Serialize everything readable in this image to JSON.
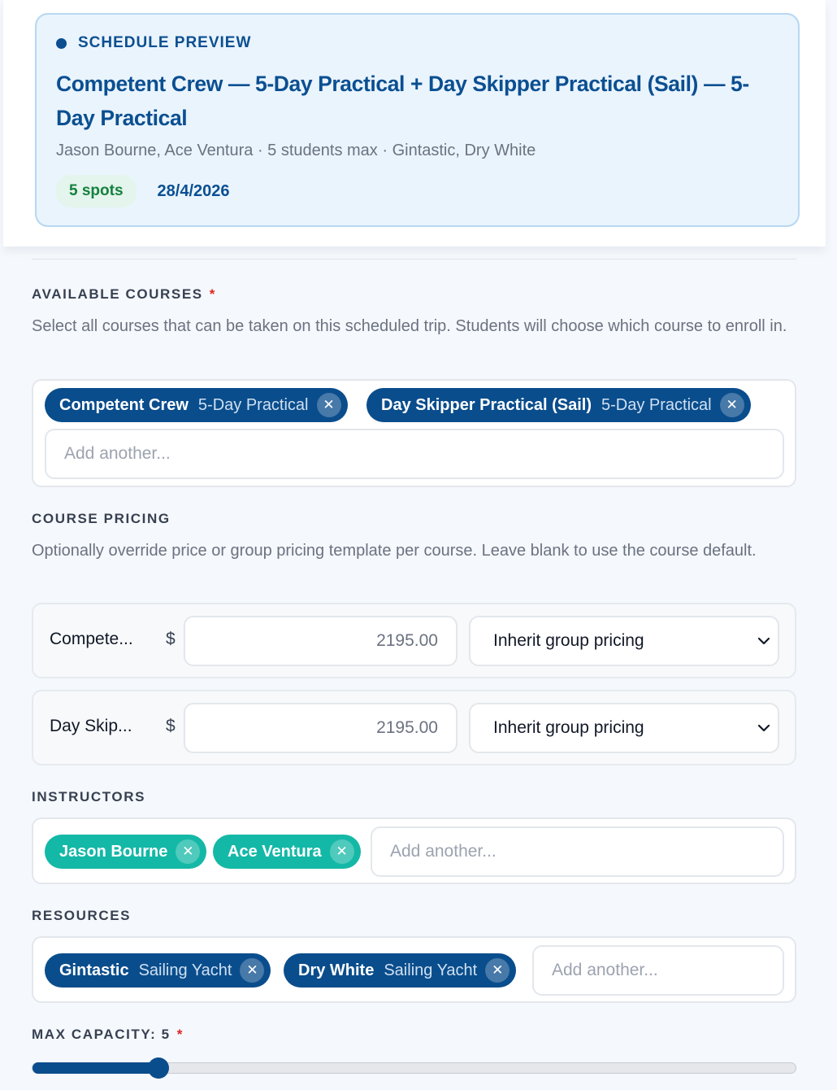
{
  "preview": {
    "eyebrow": "SCHEDULE PREVIEW",
    "title": "Competent Crew — 5-Day Practical + Day Skipper Practical (Sail) — 5-Day Practical",
    "meta": "Jason Bourne, Ace Ventura · 5 students max · Gintastic, Dry White",
    "spots": "5 spots",
    "date": "28/4/2026"
  },
  "courses": {
    "label": "AVAILABLE COURSES",
    "required": "*",
    "help": "Select all courses that can be taken on this scheduled trip. Students will choose which course to enroll in.",
    "chips": [
      {
        "name": "Competent Crew",
        "sub": "5-Day Practical"
      },
      {
        "name": "Day Skipper Practical (Sail)",
        "sub": "5-Day Practical"
      }
    ],
    "remove_glyph": "✕",
    "add_placeholder": "Add another..."
  },
  "pricing": {
    "label": "COURSE PRICING",
    "help": "Optionally override price or group pricing template per course. Leave blank to use the course default.",
    "currency": "$",
    "rows": [
      {
        "name": "Compete...",
        "price": "2195.00",
        "template": "Inherit group pricing"
      },
      {
        "name": "Day Skip...",
        "price": "2195.00",
        "template": "Inherit group pricing"
      }
    ]
  },
  "instructors": {
    "label": "INSTRUCTORS",
    "chips": [
      {
        "name": "Jason Bourne"
      },
      {
        "name": "Ace Ventura"
      }
    ],
    "add_placeholder": "Add another..."
  },
  "resources": {
    "label": "RESOURCES",
    "chips": [
      {
        "name": "Gintastic",
        "sub": "Sailing Yacht"
      },
      {
        "name": "Dry White",
        "sub": "Sailing Yacht"
      }
    ],
    "add_placeholder": "Add another..."
  },
  "capacity": {
    "label": "MAX CAPACITY: 5",
    "required": "*",
    "value": 5,
    "fraction": 0.166
  },
  "colors": {
    "brand": "#0a4d8c",
    "teal": "#14b8a6",
    "required": "#dc2626",
    "success": "#15803d"
  }
}
